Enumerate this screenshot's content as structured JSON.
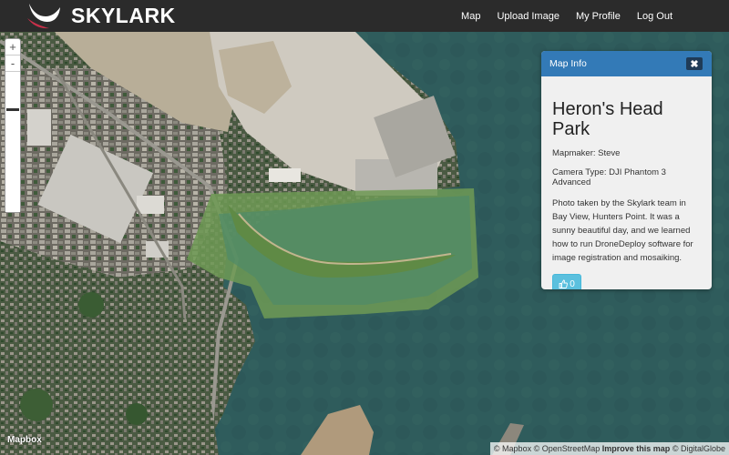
{
  "app": {
    "brand": "SKYLARK"
  },
  "nav": {
    "items": [
      {
        "label": "Map"
      },
      {
        "label": "Upload Image"
      },
      {
        "label": "My Profile"
      },
      {
        "label": "Log Out"
      }
    ]
  },
  "map": {
    "zoom_in": "+",
    "zoom_out": "-",
    "logo": "Mapbox",
    "attribution": {
      "mapbox": "© Mapbox",
      "osm": "© OpenStreetMap",
      "improve": "Improve this map",
      "digitalglobe": "© DigitalGlobe"
    }
  },
  "panel": {
    "header": "Map Info",
    "close_label": "✖",
    "title": "Heron's Head Park",
    "mapmaker": "Mapmaker: Steve",
    "camera": "Camera Type: DJI Phantom 3 Advanced",
    "description": "Photo taken by the Skylark team in Bay View, Hunters Point. It was a sunny beautiful day, and we learned how to run DroneDeploy software for image registration and mosaiking.",
    "likes": "0"
  },
  "colors": {
    "navbar": "#2b2b2b",
    "panel_header": "#337ab7",
    "like_button": "#5bc0de",
    "water": "#2f5a5a",
    "overlay": "#6f9a55"
  }
}
